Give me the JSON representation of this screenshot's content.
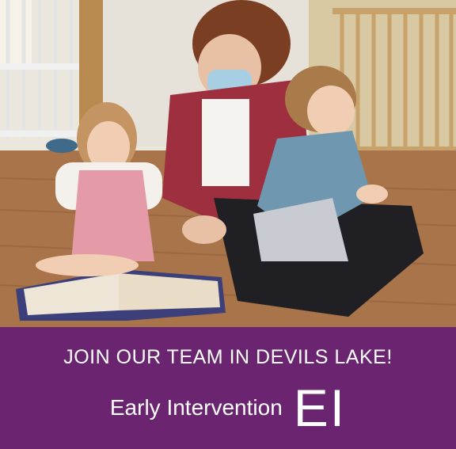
{
  "photo": {
    "alt": "Early intervention provider reading a picture book with two toddlers on a wooden floor"
  },
  "banner": {
    "headline": "JOIN OUR TEAM IN DEVILS LAKE!",
    "program": "Early Intervention",
    "abbreviation": "EI"
  },
  "colors": {
    "banner_background": "#6b2570",
    "banner_text": "#ffffff"
  }
}
